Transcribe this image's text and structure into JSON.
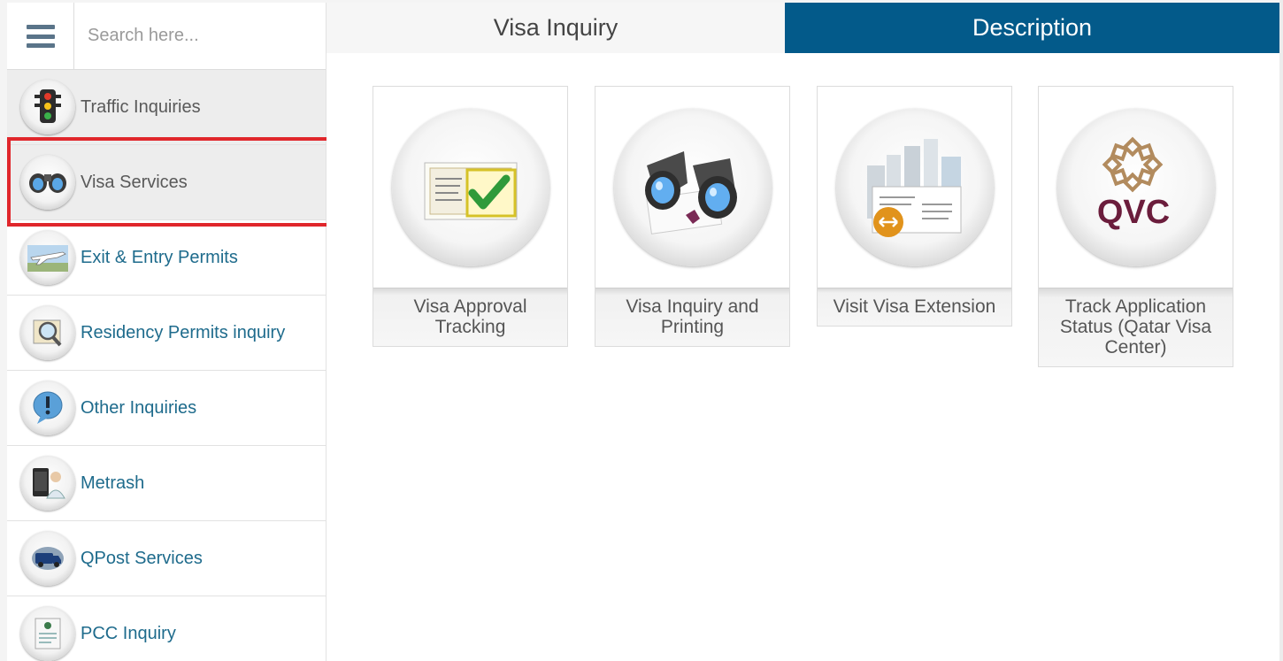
{
  "search": {
    "placeholder": "Search here..."
  },
  "sidebar": {
    "items": [
      {
        "label": "Traffic Inquiries",
        "icon": "traffic-light-icon"
      },
      {
        "label": "Visa Services",
        "icon": "binoculars-icon"
      },
      {
        "label": "Exit & Entry Permits",
        "icon": "airplane-icon"
      },
      {
        "label": "Residency Permits inquiry",
        "icon": "magnifier-document-icon"
      },
      {
        "label": "Other Inquiries",
        "icon": "exclamation-bubble-icon"
      },
      {
        "label": "Metrash",
        "icon": "phone-user-icon"
      },
      {
        "label": "QPost Services",
        "icon": "delivery-van-icon"
      },
      {
        "label": "PCC Inquiry",
        "icon": "certificate-icon"
      }
    ]
  },
  "tabs": {
    "inquiry": "Visa Inquiry",
    "description": "Description"
  },
  "cards": [
    {
      "label": "Visa Approval Tracking",
      "icon": "approved-document-icon"
    },
    {
      "label": "Visa Inquiry and Printing",
      "icon": "binoculars-icon"
    },
    {
      "label": "Visit Visa Extension",
      "icon": "visa-extension-icon"
    },
    {
      "label": "Track Application Status (Qatar Visa Center)",
      "icon": "qvc-logo-icon",
      "logo_text": "QVC"
    }
  ],
  "colors": {
    "accent": "#035a8a",
    "link": "#1e6b8c",
    "highlight": "#e0262b",
    "qvc": "#6b1d3c"
  }
}
